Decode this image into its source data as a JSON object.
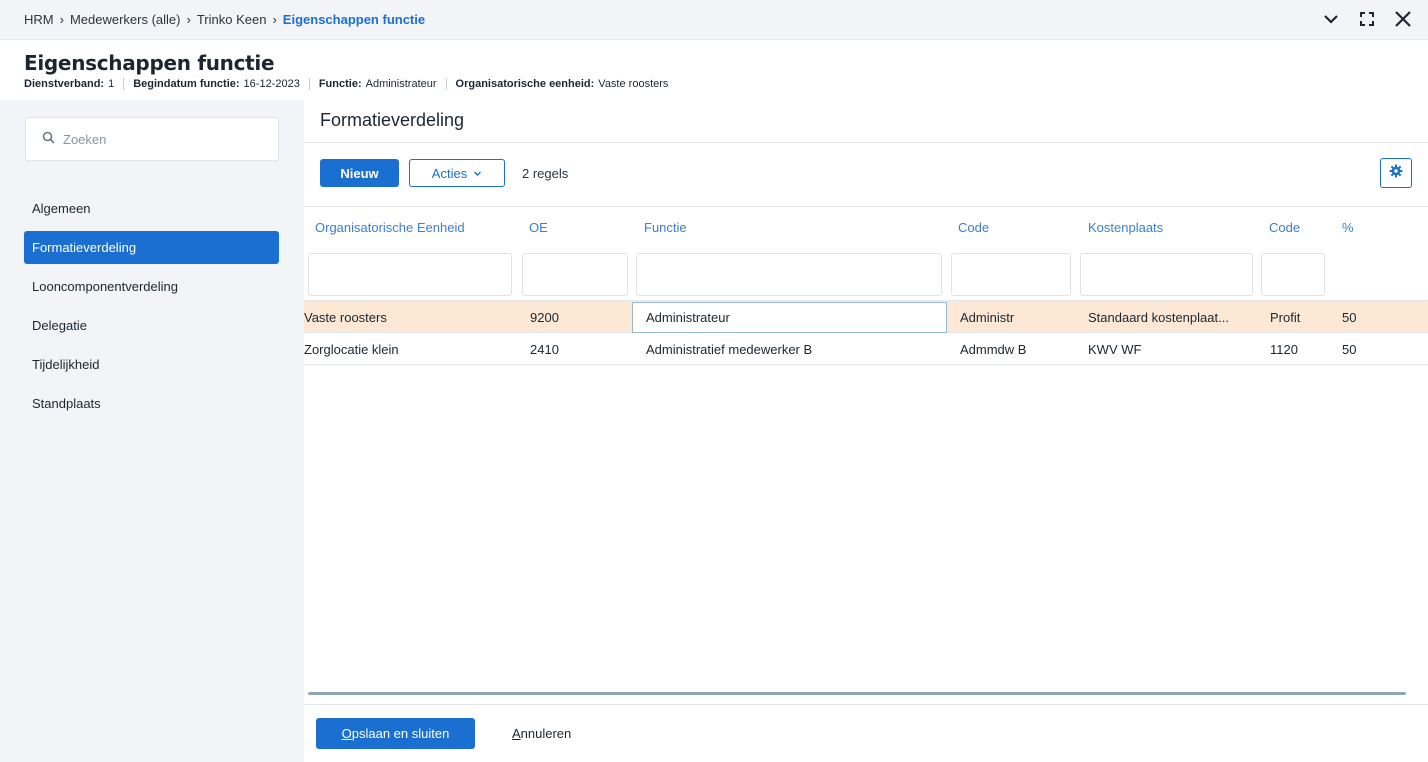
{
  "breadcrumb": {
    "items": [
      "HRM",
      "Medewerkers (alle)",
      "Trinko Keen"
    ],
    "current": "Eigenschappen functie",
    "separator": "›"
  },
  "window_controls": [
    "chevron-down-icon",
    "fullscreen-icon",
    "close-icon"
  ],
  "header": {
    "title": "Eigenschappen functie",
    "meta": [
      {
        "label": "Dienstverband:",
        "value": "1"
      },
      {
        "label": "Begindatum functie:",
        "value": "16-12-2023"
      },
      {
        "label": "Functie:",
        "value": "Administrateur"
      },
      {
        "label": "Organisatorische eenheid:",
        "value": "Vaste roosters"
      }
    ]
  },
  "sidebar": {
    "search_placeholder": "Zoeken",
    "items": [
      {
        "label": "Algemeen",
        "active": false
      },
      {
        "label": "Formatieverdeling",
        "active": true
      },
      {
        "label": "Looncomponentverdeling",
        "active": false
      },
      {
        "label": "Delegatie",
        "active": false
      },
      {
        "label": "Tijdelijkheid",
        "active": false
      },
      {
        "label": "Standplaats",
        "active": false
      }
    ]
  },
  "main": {
    "section_title": "Formatieverdeling",
    "toolbar": {
      "new_label": "Nieuw",
      "actions_label": "Acties",
      "count_label": "2 regels"
    },
    "table": {
      "columns": [
        "Organisatorische Eenheid",
        "OE",
        "Functie",
        "Code",
        "Kostenplaats",
        "Code",
        "%"
      ],
      "rows": [
        [
          "Vaste roosters",
          "9200",
          "Administrateur",
          "Administr",
          "Standaard kostenplaat...",
          "Profit",
          "50"
        ],
        [
          "Zorglocatie klein",
          "2410",
          "Administratief medewerker B",
          "Admmdw B",
          "KWV WF",
          "1120",
          "50"
        ]
      ],
      "selected_row": 0
    }
  },
  "footer": {
    "save_label_u": "O",
    "save_label_rest": "pslaan en sluiten",
    "cancel_label_u": "A",
    "cancel_label_rest": "nnuleren"
  },
  "colors": {
    "accent": "#1a6fd1",
    "selected_row": "#fde8d5",
    "header_link": "#3a7fd5",
    "sidebar_bg": "#f2f4f7"
  }
}
